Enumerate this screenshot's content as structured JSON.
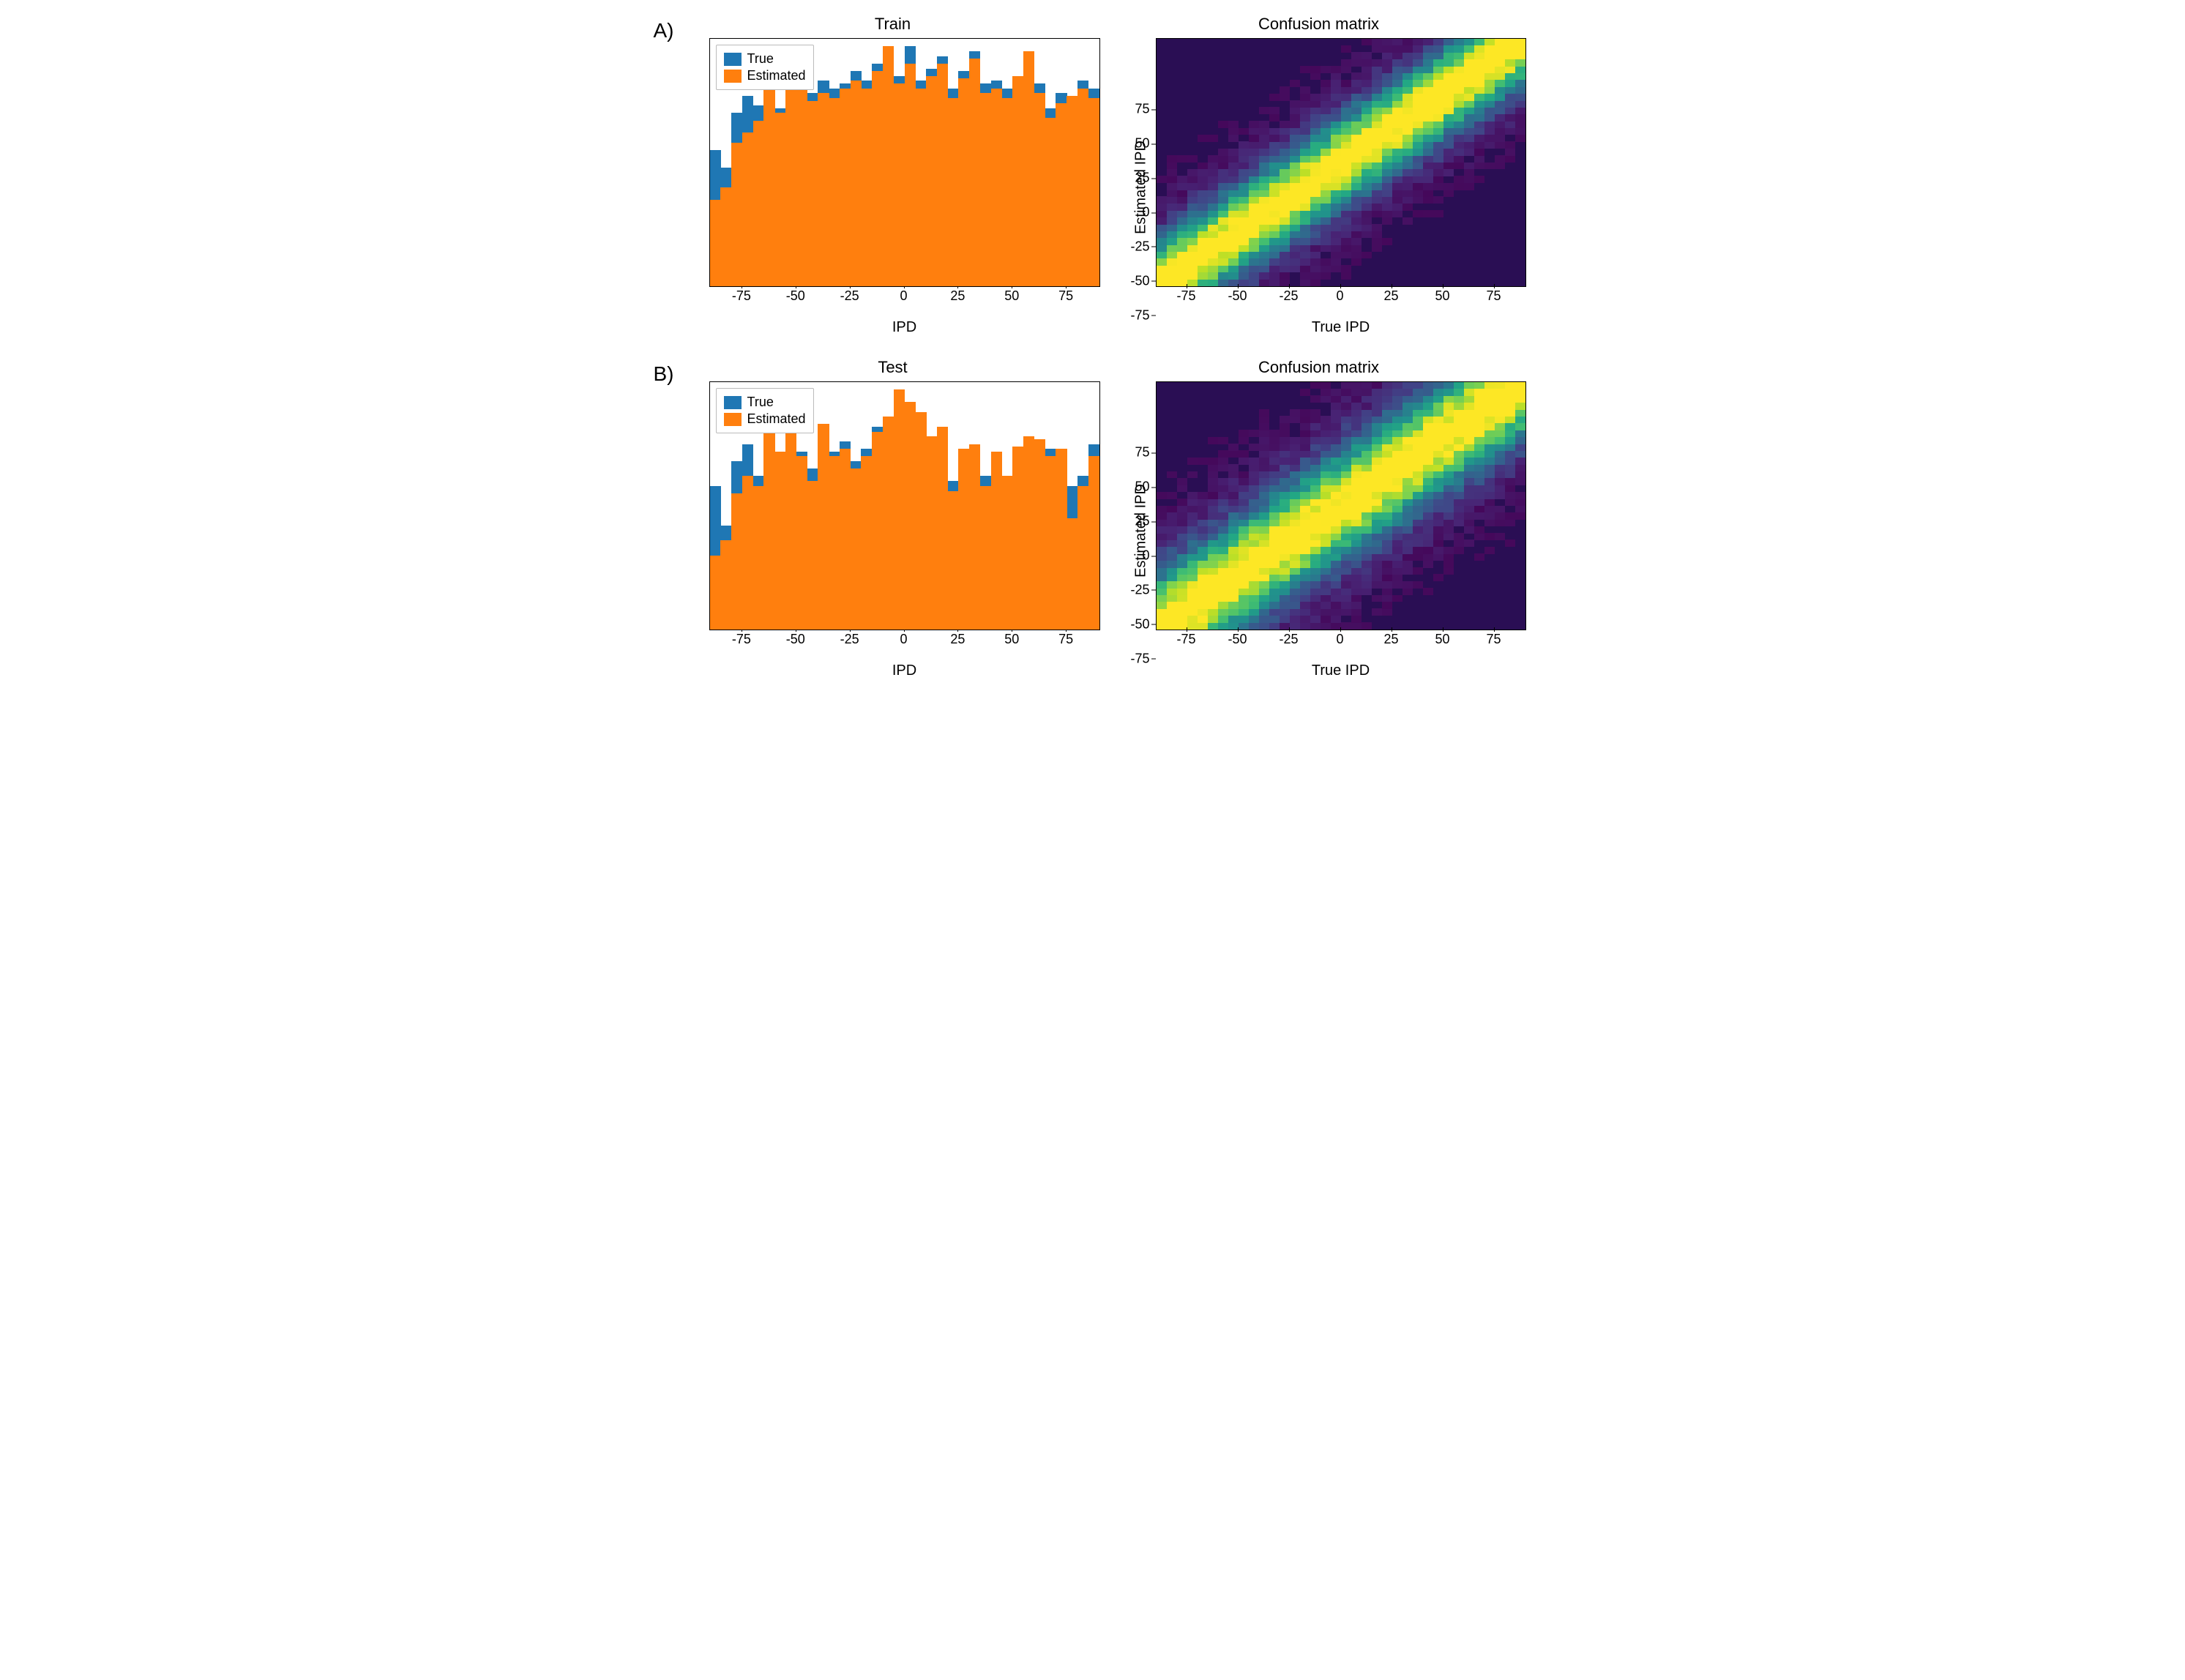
{
  "colors": {
    "true": "#1f77b4",
    "estimated": "#ff7f0e",
    "viridis": [
      "#440154",
      "#482475",
      "#414487",
      "#355f8d",
      "#2a788e",
      "#21918c",
      "#22a884",
      "#44bf70",
      "#7ad151",
      "#bddf26",
      "#fde725"
    ]
  },
  "panels": {
    "A": {
      "left": {
        "title": "Train",
        "xlabel": "IPD",
        "legend": [
          "True",
          "Estimated"
        ]
      },
      "right": {
        "title": "Confusion matrix",
        "xlabel": "True IPD",
        "ylabel": "Estimated IPD"
      }
    },
    "B": {
      "left": {
        "title": "Test",
        "xlabel": "IPD",
        "legend": [
          "True",
          "Estimated"
        ]
      },
      "right": {
        "title": "Confusion matrix",
        "xlabel": "True IPD",
        "ylabel": "Estimated IPD"
      }
    }
  },
  "chart_data": [
    {
      "id": "A-hist",
      "type": "bar",
      "title": "Train",
      "xlabel": "IPD",
      "ylabel": "",
      "xlim": [
        -90,
        90
      ],
      "ylim": [
        0,
        1.0
      ],
      "xticks": [
        -75,
        -50,
        -25,
        0,
        25,
        50,
        75
      ],
      "categories": [
        -90,
        -85,
        -80,
        -75,
        -70,
        -65,
        -60,
        -55,
        -50,
        -45,
        -40,
        -35,
        -30,
        -25,
        -20,
        -15,
        -10,
        -5,
        0,
        5,
        10,
        15,
        20,
        25,
        30,
        35,
        40,
        45,
        50,
        55,
        60,
        65,
        70,
        75,
        80,
        85
      ],
      "series": [
        {
          "name": "True",
          "values": [
            0.55,
            0.48,
            0.7,
            0.77,
            0.73,
            0.83,
            0.72,
            0.88,
            0.85,
            0.78,
            0.83,
            0.8,
            0.82,
            0.87,
            0.83,
            0.9,
            0.88,
            0.85,
            0.97,
            0.83,
            0.88,
            0.93,
            0.8,
            0.87,
            0.95,
            0.82,
            0.83,
            0.8,
            0.78,
            0.9,
            0.82,
            0.72,
            0.78,
            0.73,
            0.83,
            0.8
          ]
        },
        {
          "name": "Estimated",
          "values": [
            0.35,
            0.4,
            0.58,
            0.62,
            0.67,
            0.8,
            0.7,
            0.85,
            0.82,
            0.75,
            0.78,
            0.76,
            0.8,
            0.83,
            0.8,
            0.87,
            0.97,
            0.82,
            0.9,
            0.8,
            0.85,
            0.9,
            0.76,
            0.84,
            0.92,
            0.78,
            0.8,
            0.76,
            0.85,
            0.95,
            0.78,
            0.68,
            0.74,
            0.77,
            0.8,
            0.76
          ]
        }
      ]
    },
    {
      "id": "A-conf",
      "type": "heatmap",
      "title": "Confusion matrix",
      "xlabel": "True IPD",
      "ylabel": "Estimated IPD",
      "xlim": [
        -90,
        90
      ],
      "ylim": [
        -90,
        90
      ],
      "xticks": [
        -75,
        -50,
        -25,
        0,
        25,
        50,
        75
      ],
      "yticks": [
        -75,
        -50,
        -25,
        0,
        25,
        50,
        75
      ],
      "note": "diagonal-dominant, spread ~25, corners brighter"
    },
    {
      "id": "B-hist",
      "type": "bar",
      "title": "Test",
      "xlabel": "IPD",
      "ylabel": "",
      "xlim": [
        -90,
        90
      ],
      "ylim": [
        0,
        1.0
      ],
      "xticks": [
        -75,
        -50,
        -25,
        0,
        25,
        50,
        75
      ],
      "categories": [
        -90,
        -85,
        -80,
        -75,
        -70,
        -65,
        -60,
        -55,
        -50,
        -45,
        -40,
        -35,
        -30,
        -25,
        -20,
        -15,
        -10,
        -5,
        0,
        5,
        10,
        15,
        20,
        25,
        30,
        35,
        40,
        45,
        50,
        55,
        60,
        65,
        70,
        75,
        80,
        85
      ],
      "series": [
        {
          "name": "True",
          "values": [
            0.58,
            0.42,
            0.68,
            0.75,
            0.62,
            0.8,
            0.7,
            0.82,
            0.72,
            0.65,
            0.8,
            0.72,
            0.76,
            0.68,
            0.73,
            0.82,
            0.78,
            0.8,
            0.9,
            0.86,
            0.75,
            0.8,
            0.6,
            0.7,
            0.73,
            0.62,
            0.7,
            0.6,
            0.72,
            0.75,
            0.65,
            0.73,
            0.7,
            0.58,
            0.62,
            0.75
          ]
        },
        {
          "name": "Estimated",
          "values": [
            0.3,
            0.36,
            0.55,
            0.62,
            0.58,
            0.82,
            0.72,
            0.83,
            0.7,
            0.6,
            0.83,
            0.7,
            0.73,
            0.65,
            0.7,
            0.8,
            0.86,
            0.97,
            0.92,
            0.88,
            0.78,
            0.82,
            0.56,
            0.73,
            0.75,
            0.58,
            0.72,
            0.62,
            0.74,
            0.78,
            0.77,
            0.7,
            0.73,
            0.45,
            0.58,
            0.7
          ]
        }
      ]
    },
    {
      "id": "B-conf",
      "type": "heatmap",
      "title": "Confusion matrix",
      "xlabel": "True IPD",
      "ylabel": "Estimated IPD",
      "xlim": [
        -90,
        90
      ],
      "ylim": [
        -90,
        90
      ],
      "xticks": [
        -75,
        -50,
        -25,
        0,
        25,
        50,
        75
      ],
      "yticks": [
        -75,
        -50,
        -25,
        0,
        25,
        50,
        75
      ],
      "note": "diagonal-dominant, spread ~30, corners brighter"
    }
  ]
}
